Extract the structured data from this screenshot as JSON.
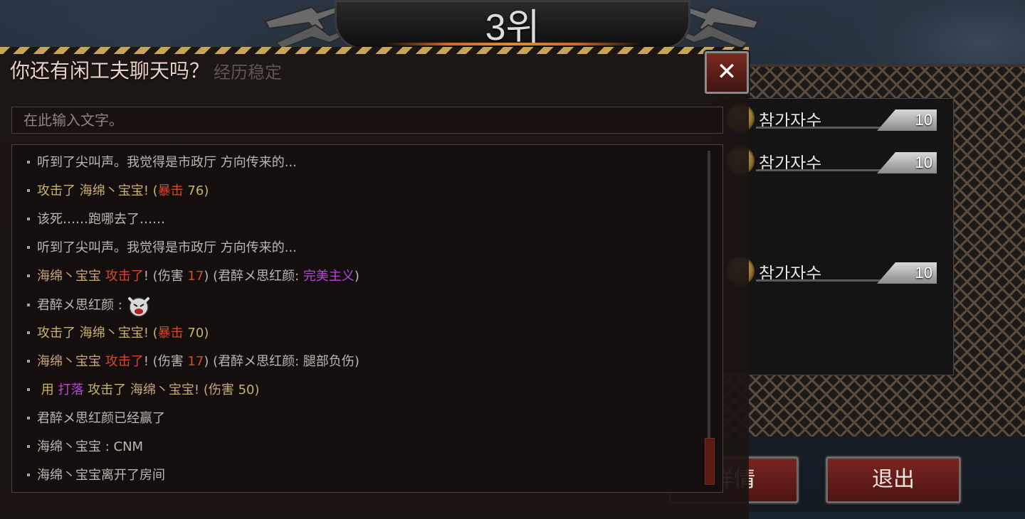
{
  "rank_banner": {
    "rank_text": "3위"
  },
  "chat": {
    "title": "你还有闲工夫聊天吗？",
    "title_ghost": "经历稳定",
    "close_icon": "✕",
    "input_placeholder": "在此输入文字。",
    "lines": [
      {
        "segments": [
          {
            "text": "听到了尖叫声。我觉得是市政厅 方向传来的...",
            "color": "plain"
          }
        ]
      },
      {
        "segments": [
          {
            "text": "攻击了 海绵丶宝宝! (",
            "color": "gold"
          },
          {
            "text": "暴击",
            "color": "red"
          },
          {
            "text": " 76",
            "color": "gold"
          },
          {
            "text": ")",
            "color": "gold"
          }
        ]
      },
      {
        "segments": [
          {
            "text": "该死……跑哪去了……",
            "color": "plain"
          }
        ]
      },
      {
        "segments": [
          {
            "text": "听到了尖叫声。我觉得是市政厅 方向传来的...",
            "color": "plain"
          }
        ]
      },
      {
        "segments": [
          {
            "text": "海绵丶宝宝  ",
            "color": "tan"
          },
          {
            "text": "攻击了",
            "color": "red"
          },
          {
            "text": "! (伤害 ",
            "color": "plain"
          },
          {
            "text": "17",
            "color": "red"
          },
          {
            "text": ") (君醉メ思红颜: ",
            "color": "plain"
          },
          {
            "text": "完美主义",
            "color": "purple"
          },
          {
            "text": ")",
            "color": "plain"
          }
        ]
      },
      {
        "segments": [
          {
            "text": "君醉メ思红颜 :",
            "color": "plain"
          }
        ],
        "emoji": "angry-face-icon"
      },
      {
        "segments": [
          {
            "text": "攻击了 海绵丶宝宝! (",
            "color": "gold"
          },
          {
            "text": "暴击",
            "color": "red"
          },
          {
            "text": " 70",
            "color": "gold"
          },
          {
            "text": ")",
            "color": "gold"
          }
        ]
      },
      {
        "segments": [
          {
            "text": "海绵丶宝宝  ",
            "color": "tan"
          },
          {
            "text": "攻击了",
            "color": "red"
          },
          {
            "text": "! (伤害 ",
            "color": "plain"
          },
          {
            "text": "17",
            "color": "red"
          },
          {
            "text": ") (君醉メ思红颜: 腿部负伤)",
            "color": "plain"
          }
        ]
      },
      {
        "segments": [
          {
            "text": " 用 ",
            "color": "gold"
          },
          {
            "text": "打落",
            "color": "purple"
          },
          {
            "text": " 攻击了  ",
            "color": "gold"
          },
          {
            "text": "海绵丶宝宝! (伤害 ",
            "color": "tan"
          },
          {
            "text": "50",
            "color": "gold"
          },
          {
            "text": ")",
            "color": "tan"
          }
        ]
      },
      {
        "segments": [
          {
            "text": "君醉メ思红颜已经赢了",
            "color": "plain"
          }
        ]
      },
      {
        "segments": [
          {
            "text": "海绵丶宝宝 : CNM",
            "color": "plain"
          }
        ]
      },
      {
        "segments": [
          {
            "text": "海绵丶宝宝离开了房间",
            "color": "plain"
          }
        ]
      }
    ]
  },
  "participants": [
    {
      "label": "참가자수",
      "count": "10"
    },
    {
      "label": "참가자수",
      "count": "10"
    },
    {
      "label": "참가자수",
      "count": "10"
    }
  ],
  "buttons": {
    "details_label": "详情",
    "exit_label": "退出"
  },
  "colors": {
    "plain": "#bcb6b2",
    "gold": "#c8b36a",
    "red": "#d24a28",
    "purple": "#b14ad0",
    "tan": "#c8a87a"
  }
}
